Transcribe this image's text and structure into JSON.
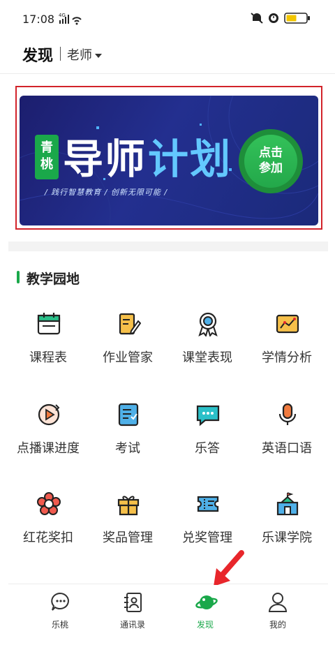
{
  "status_bar": {
    "time": "17:08",
    "network": "4G"
  },
  "header": {
    "title": "发现",
    "role": "老师"
  },
  "banner": {
    "badge": [
      "青",
      "桃"
    ],
    "title_white": "导师",
    "title_blue": "计划",
    "subtitle": "/ 践行智慧教育 / 创新无限可能 /",
    "cta": [
      "点击",
      "参加"
    ]
  },
  "section": {
    "title": "教学园地"
  },
  "grid": [
    {
      "label": "课程表",
      "icon": "calendar-icon"
    },
    {
      "label": "作业管家",
      "icon": "homework-icon"
    },
    {
      "label": "课堂表现",
      "icon": "medal-icon"
    },
    {
      "label": "学情分析",
      "icon": "chart-icon"
    },
    {
      "label": "点播课进度",
      "icon": "play-icon"
    },
    {
      "label": "考试",
      "icon": "exam-icon"
    },
    {
      "label": "乐答",
      "icon": "chat-icon"
    },
    {
      "label": "英语口语",
      "icon": "microphone-icon"
    },
    {
      "label": "红花奖扣",
      "icon": "flower-icon"
    },
    {
      "label": "奖品管理",
      "icon": "gift-icon"
    },
    {
      "label": "兑奖管理",
      "icon": "ticket-icon"
    },
    {
      "label": "乐课学院",
      "icon": "school-icon"
    }
  ],
  "tabs": [
    {
      "label": "乐桃",
      "icon": "chat-bubble-icon",
      "active": false
    },
    {
      "label": "通讯录",
      "icon": "contacts-icon",
      "active": false
    },
    {
      "label": "发现",
      "icon": "planet-icon",
      "active": true
    },
    {
      "label": "我的",
      "icon": "person-icon",
      "active": false
    }
  ],
  "colors": {
    "accent": "#1aa84a",
    "highlight_frame": "#d2232a",
    "arrow": "#e8262b"
  }
}
